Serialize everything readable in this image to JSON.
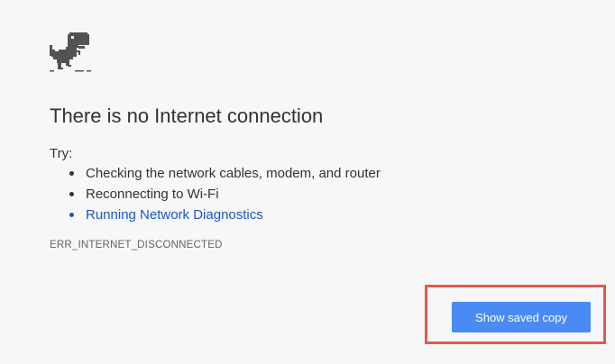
{
  "error_page": {
    "title": "There is no Internet connection",
    "try_label": "Try:",
    "suggestions": [
      "Checking the network cables, modem, and router",
      "Reconnecting to Wi-Fi"
    ],
    "diagnostics_link": "Running Network Diagnostics",
    "error_code": "ERR_INTERNET_DISCONNECTED",
    "show_saved_copy_label": "Show saved copy"
  },
  "colors": {
    "background": "#f7f7f7",
    "text": "#333333",
    "link": "#1a56c9",
    "button": "#4a8af4",
    "highlight_outline": "#e35a4e"
  },
  "icons": {
    "dino": "offline-dino-icon"
  }
}
